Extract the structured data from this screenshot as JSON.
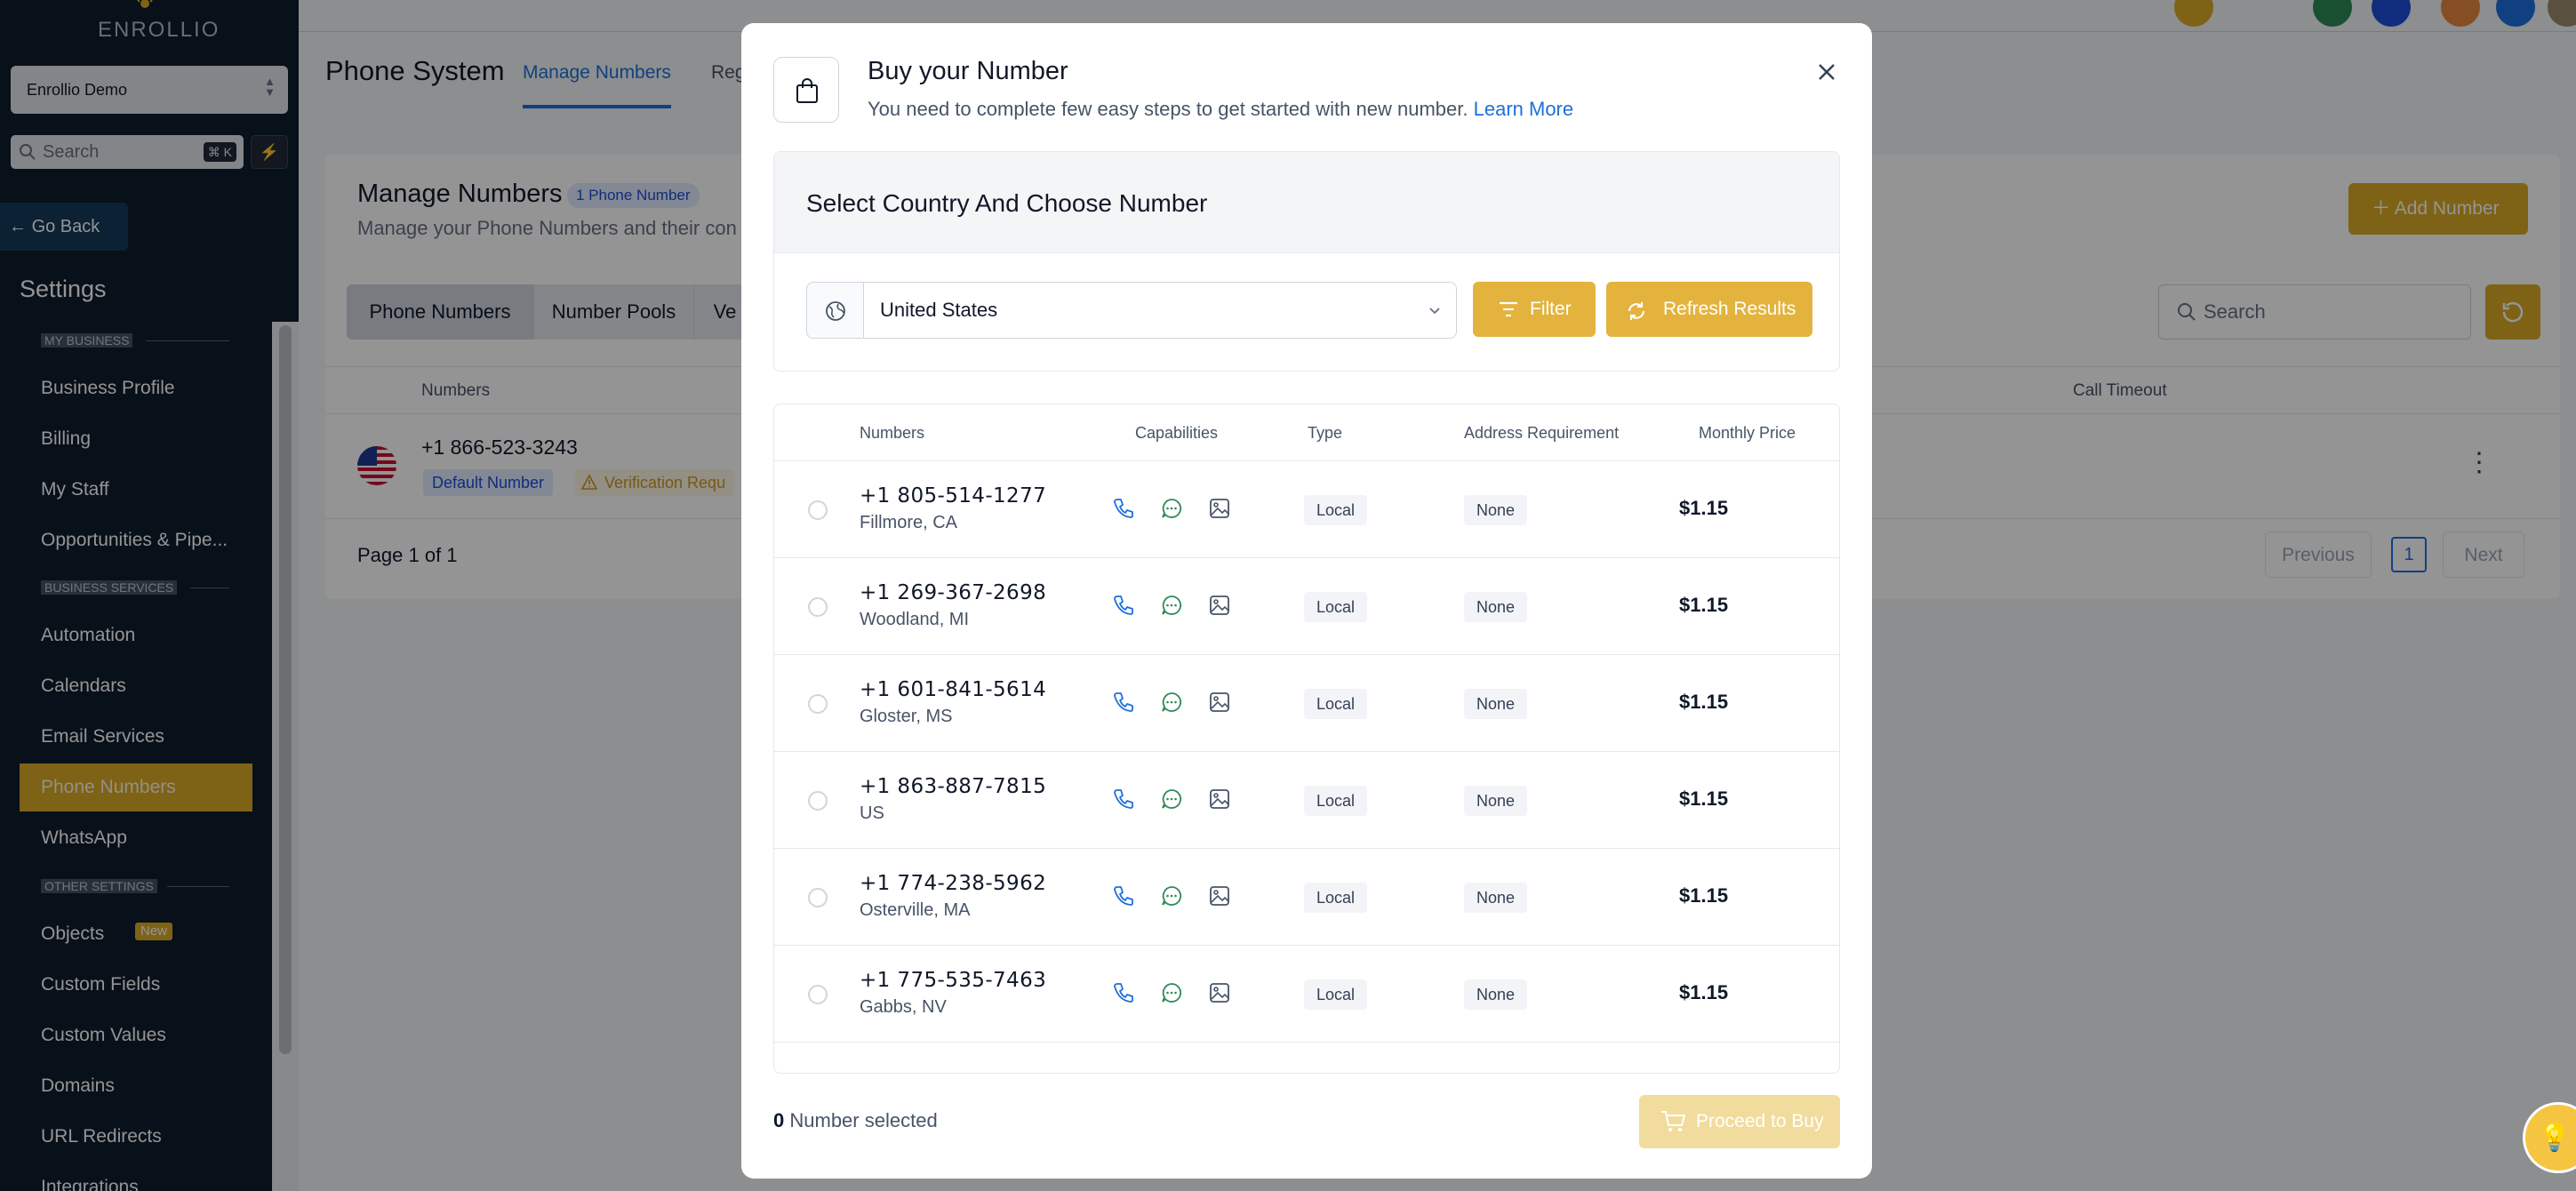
{
  "sidebar": {
    "logo": "ENROLLIO",
    "location": "Enrollio Demo",
    "search_placeholder": "Search",
    "search_shortcut": "⌘ K",
    "go_back": "Go Back",
    "title": "Settings",
    "sections": [
      {
        "header": "MY BUSINESS",
        "items": [
          "Business Profile",
          "Billing",
          "My Staff",
          "Opportunities & Pipe..."
        ]
      },
      {
        "header": "BUSINESS SERVICES",
        "items": [
          "Automation",
          "Calendars",
          "Email Services",
          "Phone Numbers",
          "WhatsApp"
        ]
      },
      {
        "header": "OTHER SETTINGS",
        "items": [
          "Objects",
          "Custom Fields",
          "Custom Values",
          "Domains",
          "URL Redirects",
          "Integrations"
        ]
      }
    ],
    "active_item": "Phone Numbers",
    "new_badge": "New"
  },
  "main": {
    "page_title": "Phone System",
    "tabs": [
      "Manage Numbers",
      "Reg"
    ],
    "card_title": "Manage Numbers",
    "count_badge": "1 Phone Number",
    "card_subtitle": "Manage your Phone Numbers and their con",
    "add_number": "Add Number",
    "segments": [
      "Phone Numbers",
      "Number Pools",
      "Ve"
    ],
    "search_placeholder": "Search",
    "columns": {
      "numbers": "Numbers",
      "call_timeout": "Call Timeout"
    },
    "row": {
      "number": "+1 866-523-3243",
      "default_badge": "Default Number",
      "verification_badge": "Verification Requ"
    },
    "page_info": "Page 1 of 1",
    "pagination": {
      "previous": "Previous",
      "current": "1",
      "next": "Next"
    }
  },
  "modal": {
    "title": "Buy your Number",
    "subtitle": "You need to complete few easy steps to get started with new number.",
    "learn_more": "Learn More",
    "section_title": "Select Country And Choose Number",
    "country": "United States",
    "filter_label": "Filter",
    "refresh_label": "Refresh Results",
    "columns": {
      "numbers": "Numbers",
      "capabilities": "Capabilities",
      "type": "Type",
      "address": "Address Requirement",
      "price": "Monthly Price"
    },
    "rows": [
      {
        "number": "+1 805-514-1277",
        "location": "Fillmore, CA",
        "type": "Local",
        "address": "None",
        "price": "$1.15"
      },
      {
        "number": "+1 269-367-2698",
        "location": "Woodland, MI",
        "type": "Local",
        "address": "None",
        "price": "$1.15"
      },
      {
        "number": "+1 601-841-5614",
        "location": "Gloster, MS",
        "type": "Local",
        "address": "None",
        "price": "$1.15"
      },
      {
        "number": "+1 863-887-7815",
        "location": "US",
        "type": "Local",
        "address": "None",
        "price": "$1.15"
      },
      {
        "number": "+1 774-238-5962",
        "location": "Osterville, MA",
        "type": "Local",
        "address": "None",
        "price": "$1.15"
      },
      {
        "number": "+1 775-535-7463",
        "location": "Gabbs, NV",
        "type": "Local",
        "address": "None",
        "price": "$1.15"
      }
    ],
    "selected_count": "0",
    "selected_label": "Number selected",
    "proceed_label": "Proceed to Buy"
  },
  "colors": {
    "accent": "#d9a927",
    "sidebar_bg": "#0f1c2e",
    "link_blue": "#1d6fdc",
    "capability_phone": "#1d6fdc",
    "capability_sms": "#2e8b57",
    "capability_mms": "#475467"
  }
}
